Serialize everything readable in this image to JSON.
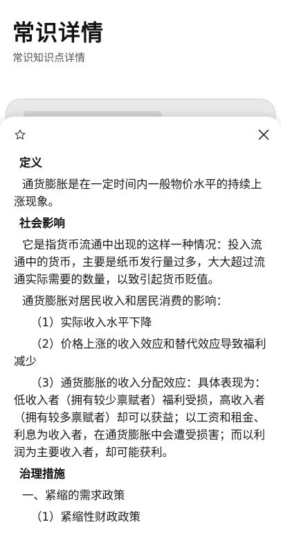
{
  "header": {
    "title": "常识详情",
    "subtitle": "常识知识点详情"
  },
  "icons": {
    "favorite": "star-outline-icon",
    "close": "close-icon"
  },
  "detail": {
    "definition": {
      "heading": "定义",
      "text": "通货膨胀是在一定时间内一般物价水平的持续上涨现象。"
    },
    "impact": {
      "heading": "社会影响",
      "paragraphs": [
        "它是指货币流通中出现的这样一种情况：投入流通中的货币，主要是纸币发行量过多，大大超过流通实际需要的数量，以致引起货币贬值。",
        "通货膨胀对居民收入和居民消费的影响："
      ],
      "items": [
        "（1）实际收入水平下降",
        "（2）价格上涨的收入效应和替代效应导致福利减少",
        "（3）通货膨胀的收入分配效应：具体表现为：低收入者（拥有较少禀赋者）福利受损，高收入者（拥有较多禀赋者）却可以获益；以工资和租金、利息为收入者，在通货膨胀中会遭受损害；而以利润为主要收入者，却可能获利。"
      ]
    },
    "governance": {
      "heading": "治理措施",
      "lines": [
        "一、紧缩的需求政策",
        "（1）紧缩性财政政策"
      ]
    }
  }
}
